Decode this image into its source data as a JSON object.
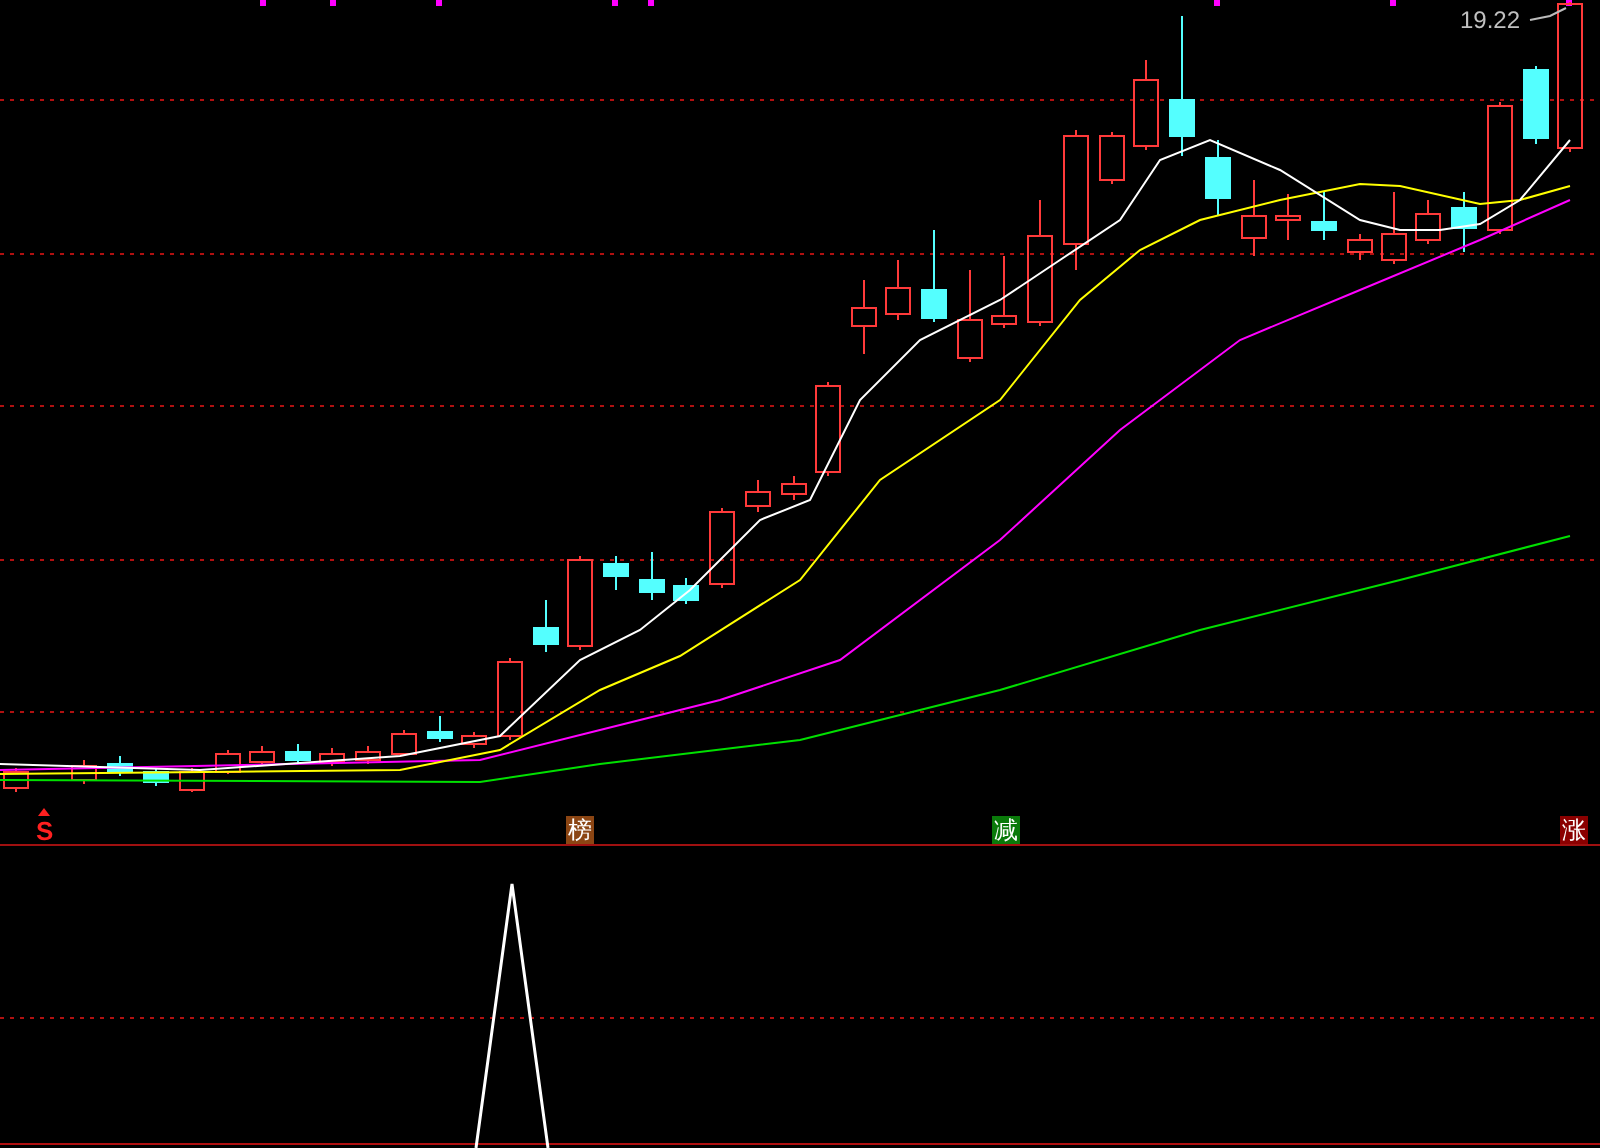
{
  "price_chart": {
    "high_label": "19.22",
    "signals": [
      {
        "kind": "arrow",
        "text": "S",
        "color": "#ff2020"
      },
      {
        "kind": "badge",
        "text": "榜",
        "color": "#8b4513"
      },
      {
        "kind": "badge",
        "text": "减",
        "color": "#0a7a0a"
      },
      {
        "kind": "badge",
        "text": "涨",
        "color": "#8b0000"
      }
    ]
  }
}
